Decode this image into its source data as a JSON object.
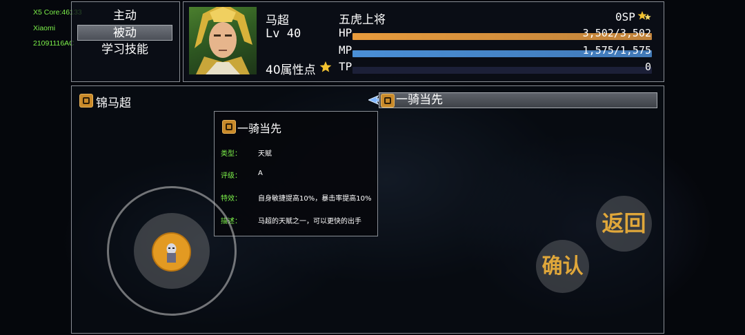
{
  "debug": {
    "line1": "X5 Core:46133",
    "line2": "Xiaomi",
    "line3": "21091116AC"
  },
  "menu": {
    "items": [
      {
        "label": "主动"
      },
      {
        "label": "被动",
        "selected": true
      },
      {
        "label": "学习技能"
      }
    ]
  },
  "character": {
    "name": "马超",
    "level": "Lv 40",
    "title": "五虎上将",
    "sp": "0SP",
    "attribute_points": "40属性点",
    "stats": [
      {
        "label": "HP",
        "value": "3,502/3,502",
        "fill": 1.0,
        "color": "#e89b3c"
      },
      {
        "label": "MP",
        "value": "1,575/1,575",
        "fill": 1.0,
        "color": "#4a8fd6"
      },
      {
        "label": "TP",
        "value": "0",
        "fill": 0.0,
        "color": "#2a3a8a"
      }
    ]
  },
  "skills": {
    "category_label": "锦马超",
    "selected_skill": "一骑当先"
  },
  "tooltip": {
    "title": "一骑当先",
    "rows": [
      {
        "key": "类型：",
        "value": "天赋"
      },
      {
        "key": "评级：",
        "value": "A"
      },
      {
        "key": "特效：",
        "value": "自身敏捷提高10%，暴击率提高10%"
      },
      {
        "key": "描述：",
        "value": "马超的天赋之一，可以更快的出手"
      }
    ]
  },
  "buttons": {
    "back": "返回",
    "confirm": "确认"
  },
  "colors": {
    "accent": "#e0a73a",
    "hp": "#e89b3c",
    "mp": "#4a8fd6",
    "tp": "#2a3a8a",
    "debug_text": "#7cf04a"
  },
  "icons": {
    "star": "star-icon",
    "skill": "skill-scroll-icon",
    "cursor": "hand-cursor-icon",
    "joystick": "joystick-knob-icon"
  }
}
